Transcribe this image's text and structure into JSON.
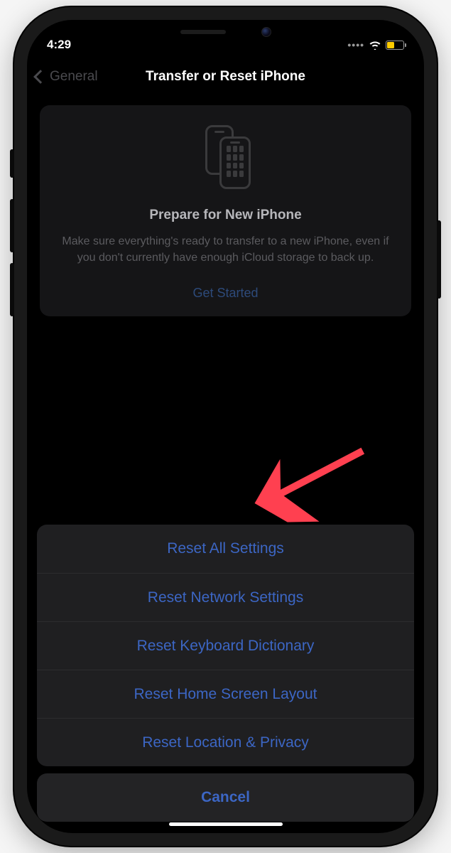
{
  "status_bar": {
    "time": "4:29"
  },
  "nav": {
    "back_label": "General",
    "title": "Transfer or Reset iPhone"
  },
  "prepare_card": {
    "title": "Prepare for New iPhone",
    "description": "Make sure everything's ready to transfer to a new iPhone, even if you don't currently have enough iCloud storage to back up.",
    "action": "Get Started"
  },
  "action_sheet": {
    "items": [
      "Reset All Settings",
      "Reset Network Settings",
      "Reset Keyboard Dictionary",
      "Reset Home Screen Layout",
      "Reset Location & Privacy"
    ],
    "cancel": "Cancel"
  },
  "colors": {
    "link": "#3c66c4",
    "accent_arrow": "#ff4050",
    "battery_fill": "#ffcc00"
  }
}
